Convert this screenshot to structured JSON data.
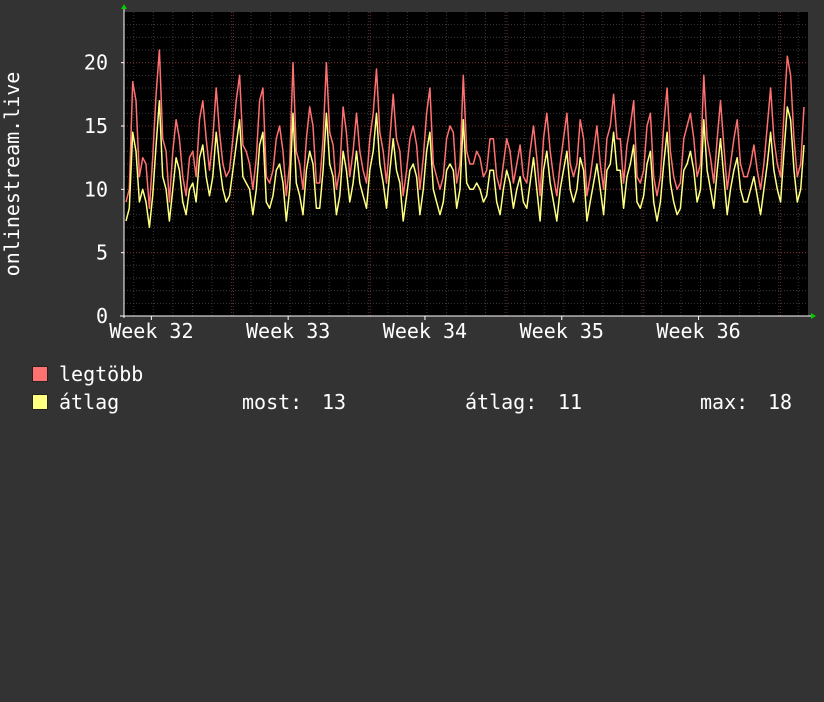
{
  "chart_data": {
    "type": "line",
    "ylabel": "onlinestream.live",
    "ylim": [
      0,
      24
    ],
    "yticks": [
      0,
      5,
      10,
      15,
      20
    ],
    "xlim": [
      0,
      100
    ],
    "xticks": [
      {
        "label": "Week 32",
        "x": 4
      },
      {
        "label": "Week 33",
        "x": 24
      },
      {
        "label": "Week 34",
        "x": 44
      },
      {
        "label": "Week 35",
        "x": 64
      },
      {
        "label": "Week 36",
        "x": 84
      }
    ],
    "grid": true,
    "background": "#000000",
    "series": [
      {
        "name": "legtöbb",
        "color": "#ff7070",
        "values": [
          9,
          10,
          18.5,
          17,
          11,
          12.5,
          12,
          8.5,
          12.5,
          17.5,
          21,
          14,
          13,
          9,
          13,
          15.5,
          14,
          11,
          9.5,
          12.5,
          13,
          11,
          15.5,
          17,
          14,
          11.5,
          14,
          18,
          14.5,
          12,
          11,
          11.5,
          14,
          17,
          19,
          13.5,
          13,
          12,
          10,
          12.5,
          17,
          18,
          11,
          10.5,
          11.5,
          14,
          15,
          13,
          9.5,
          12,
          20,
          13,
          12,
          10,
          14,
          16.5,
          15,
          10.5,
          10.5,
          14,
          20,
          14.5,
          13.5,
          10,
          11.5,
          16.5,
          14.5,
          11,
          13,
          16,
          13,
          11.5,
          10.5,
          14,
          16,
          19.5,
          14.5,
          13,
          10.5,
          14,
          17.5,
          14,
          13,
          9.5,
          11.5,
          14,
          15,
          13.5,
          10,
          12.5,
          16,
          18,
          12,
          11,
          10,
          11,
          14,
          15,
          14.5,
          10.5,
          12,
          19,
          13,
          12,
          12,
          13,
          12.5,
          11,
          11.5,
          14,
          14,
          11,
          10,
          12,
          14,
          13,
          10.5,
          12,
          13.5,
          11,
          10.5,
          13,
          15,
          12.5,
          9.5,
          14,
          16,
          13,
          11,
          9.5,
          12,
          14,
          16,
          12,
          11,
          12,
          15.5,
          14,
          9.5,
          11,
          13,
          15,
          12,
          10,
          14,
          15,
          17.5,
          14,
          14,
          10.5,
          13.5,
          15,
          17,
          11,
          10.5,
          11.5,
          15,
          16,
          11,
          9.5,
          11,
          15,
          18,
          13,
          11,
          10,
          10.5,
          14,
          15,
          16,
          14,
          11,
          12,
          19,
          14,
          12.5,
          10.5,
          14,
          17,
          13.5,
          10,
          12,
          14,
          15.5,
          12,
          11,
          11,
          12,
          13.5,
          11.5,
          10,
          12,
          15,
          18,
          14,
          12,
          11,
          16,
          20.5,
          19,
          14,
          11,
          12,
          16.5
        ],
        "current": 13,
        "average": 11,
        "max": 18
      },
      {
        "name": "átlag",
        "color": "#ffff80",
        "values": [
          7.5,
          8.5,
          14.5,
          13,
          9,
          10,
          9,
          7,
          9.5,
          13.5,
          17,
          11,
          10,
          7.5,
          10,
          12.5,
          11.5,
          9,
          8,
          10,
          10.5,
          9,
          12.5,
          13.5,
          11,
          9.5,
          11,
          14.5,
          12,
          10,
          9,
          9.5,
          11.5,
          13.5,
          15.5,
          11,
          10.5,
          10,
          8,
          10,
          13.5,
          14.5,
          9,
          8.5,
          9.5,
          11.5,
          12,
          10.5,
          7.5,
          10,
          16,
          10.5,
          9.5,
          8,
          11.5,
          13,
          12,
          8.5,
          8.5,
          11.5,
          16,
          12,
          11,
          8,
          9.5,
          13,
          11.5,
          9,
          10.5,
          13,
          10.5,
          9.5,
          8.5,
          11.5,
          13,
          16,
          12,
          10.5,
          8.5,
          11.5,
          14,
          11.5,
          10.5,
          7.5,
          9.5,
          11.5,
          12,
          11,
          8,
          10,
          13,
          14.5,
          10,
          9,
          8,
          9,
          11.5,
          12,
          11.5,
          8.5,
          10,
          15.5,
          10.5,
          10,
          10,
          10.5,
          10,
          9,
          9.5,
          11.5,
          11.5,
          9,
          8,
          10,
          11.5,
          10.5,
          8.5,
          10,
          11,
          9,
          8.5,
          10.5,
          12.5,
          10,
          7.5,
          11.5,
          13,
          10.5,
          9,
          7.5,
          10,
          11.5,
          13,
          10,
          9,
          10,
          12.5,
          11.5,
          7.5,
          9,
          10.5,
          12,
          10,
          8,
          11.5,
          12,
          14.5,
          11.5,
          11.5,
          8.5,
          11,
          12,
          13.5,
          9,
          8.5,
          9.5,
          12,
          13,
          9,
          7.5,
          9,
          12,
          14.5,
          10.5,
          9,
          8,
          8.5,
          11.5,
          12,
          13,
          11.5,
          9,
          10,
          15.5,
          11.5,
          10,
          8.5,
          11.5,
          14,
          11,
          8,
          10,
          11.5,
          12.5,
          10,
          9,
          9,
          10,
          11,
          9.5,
          8,
          10,
          12,
          14.5,
          11.5,
          10,
          9,
          13,
          16.5,
          15.5,
          11.5,
          9,
          10,
          13.5
        ]
      }
    ]
  },
  "legend": {
    "series_1_label": "legtöbb",
    "series_2_label": "átlag",
    "now_label": "most:",
    "now_value": "13",
    "avg_label": "átlag:",
    "avg_value": "11",
    "max_label": "max:",
    "max_value": "18"
  },
  "colors": {
    "page_background": "#333333",
    "plot_background": "#000000",
    "grid_minor": "#3a3a3a",
    "grid_major": "#7a2a2a",
    "axis": "#ffffff",
    "axis_arrow": "#00cc00"
  }
}
